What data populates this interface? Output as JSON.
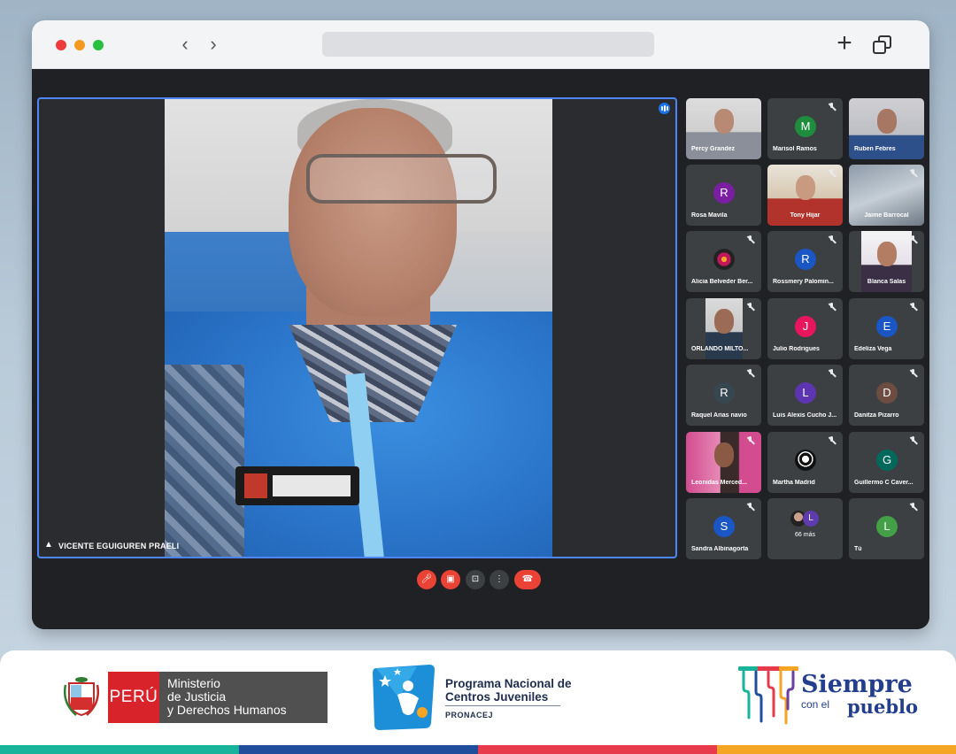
{
  "speaker": {
    "name": "VICENTE EGUIGUREN PRAELI"
  },
  "participants": [
    {
      "name": "Percy Grandez",
      "kind": "photo",
      "muted": false,
      "color": ""
    },
    {
      "name": "Marisol Ramos",
      "kind": "avatar",
      "initial": "M",
      "muted": true,
      "color": "#1e8e3e"
    },
    {
      "name": "Ruben Febres",
      "kind": "photo",
      "muted": false,
      "color": ""
    },
    {
      "name": "Rosa Mavila",
      "kind": "avatar",
      "initial": "R",
      "muted": false,
      "color": "#7b1fa2"
    },
    {
      "name": "Tony Hijar",
      "kind": "photo",
      "muted": true,
      "color": ""
    },
    {
      "name": "Jaime Barrocal",
      "kind": "photo",
      "muted": true,
      "color": ""
    },
    {
      "name": "Alicia Belveder Ber...",
      "kind": "avatar-img",
      "muted": true,
      "color": "#3c4043"
    },
    {
      "name": "Rossmery Palomin...",
      "kind": "avatar",
      "initial": "R",
      "muted": true,
      "color": "#1a56c4"
    },
    {
      "name": "Blanca Salas",
      "kind": "photo",
      "muted": true,
      "color": ""
    },
    {
      "name": "ORLANDO MILTO...",
      "kind": "photo",
      "muted": true,
      "color": ""
    },
    {
      "name": "Julio Rodrigues",
      "kind": "avatar",
      "initial": "J",
      "muted": true,
      "color": "#e8175d"
    },
    {
      "name": "Edeliza Vega",
      "kind": "avatar",
      "initial": "E",
      "muted": true,
      "color": "#1a56c4"
    },
    {
      "name": "Raquel Arias navio",
      "kind": "avatar",
      "initial": "R",
      "muted": true,
      "color": "#37474f"
    },
    {
      "name": "Luis Alexis Cucho J...",
      "kind": "avatar",
      "initial": "L",
      "muted": true,
      "color": "#5e35b1"
    },
    {
      "name": "Danitza Pizarro",
      "kind": "avatar",
      "initial": "D",
      "muted": true,
      "color": "#6d4c41"
    },
    {
      "name": "Leonidas Merced...",
      "kind": "photo",
      "muted": true,
      "color": ""
    },
    {
      "name": "Martha Madrid",
      "kind": "avatar-img",
      "muted": true,
      "color": "#3c4043"
    },
    {
      "name": "Guillermo C Caver...",
      "kind": "avatar",
      "initial": "G",
      "muted": true,
      "color": "#00695c"
    },
    {
      "name": "Sandra Albinagorta",
      "kind": "avatar",
      "initial": "S",
      "muted": true,
      "color": "#1a56c4"
    },
    {
      "name": "66 más",
      "kind": "more",
      "initial": "L",
      "muted": false,
      "color": "#5f3bb0"
    },
    {
      "name": "Tú",
      "kind": "avatar",
      "initial": "L",
      "muted": true,
      "color": "#43a047"
    }
  ],
  "controls": [
    {
      "icon": "mic-off-icon"
    },
    {
      "icon": "camera-off-icon"
    },
    {
      "icon": "present-icon"
    },
    {
      "icon": "more-options-icon"
    },
    {
      "icon": "hang-up-icon"
    }
  ],
  "footer": {
    "peru_label": "PERÚ",
    "ministry_lines": [
      "Ministerio",
      "de Justicia",
      "y Derechos Humanos"
    ],
    "pronacej_title_1": "Programa Nacional de",
    "pronacej_title_2": "Centros Juveniles",
    "pronacej_abbr": "PRONACEJ",
    "slogan_1": "Siempre",
    "slogan_2": "con el",
    "slogan_3": "pueblo",
    "colors": {
      "green": "#17b39b",
      "blue": "#1f4f9c",
      "red": "#e73a4b",
      "orange": "#f4a524"
    }
  }
}
